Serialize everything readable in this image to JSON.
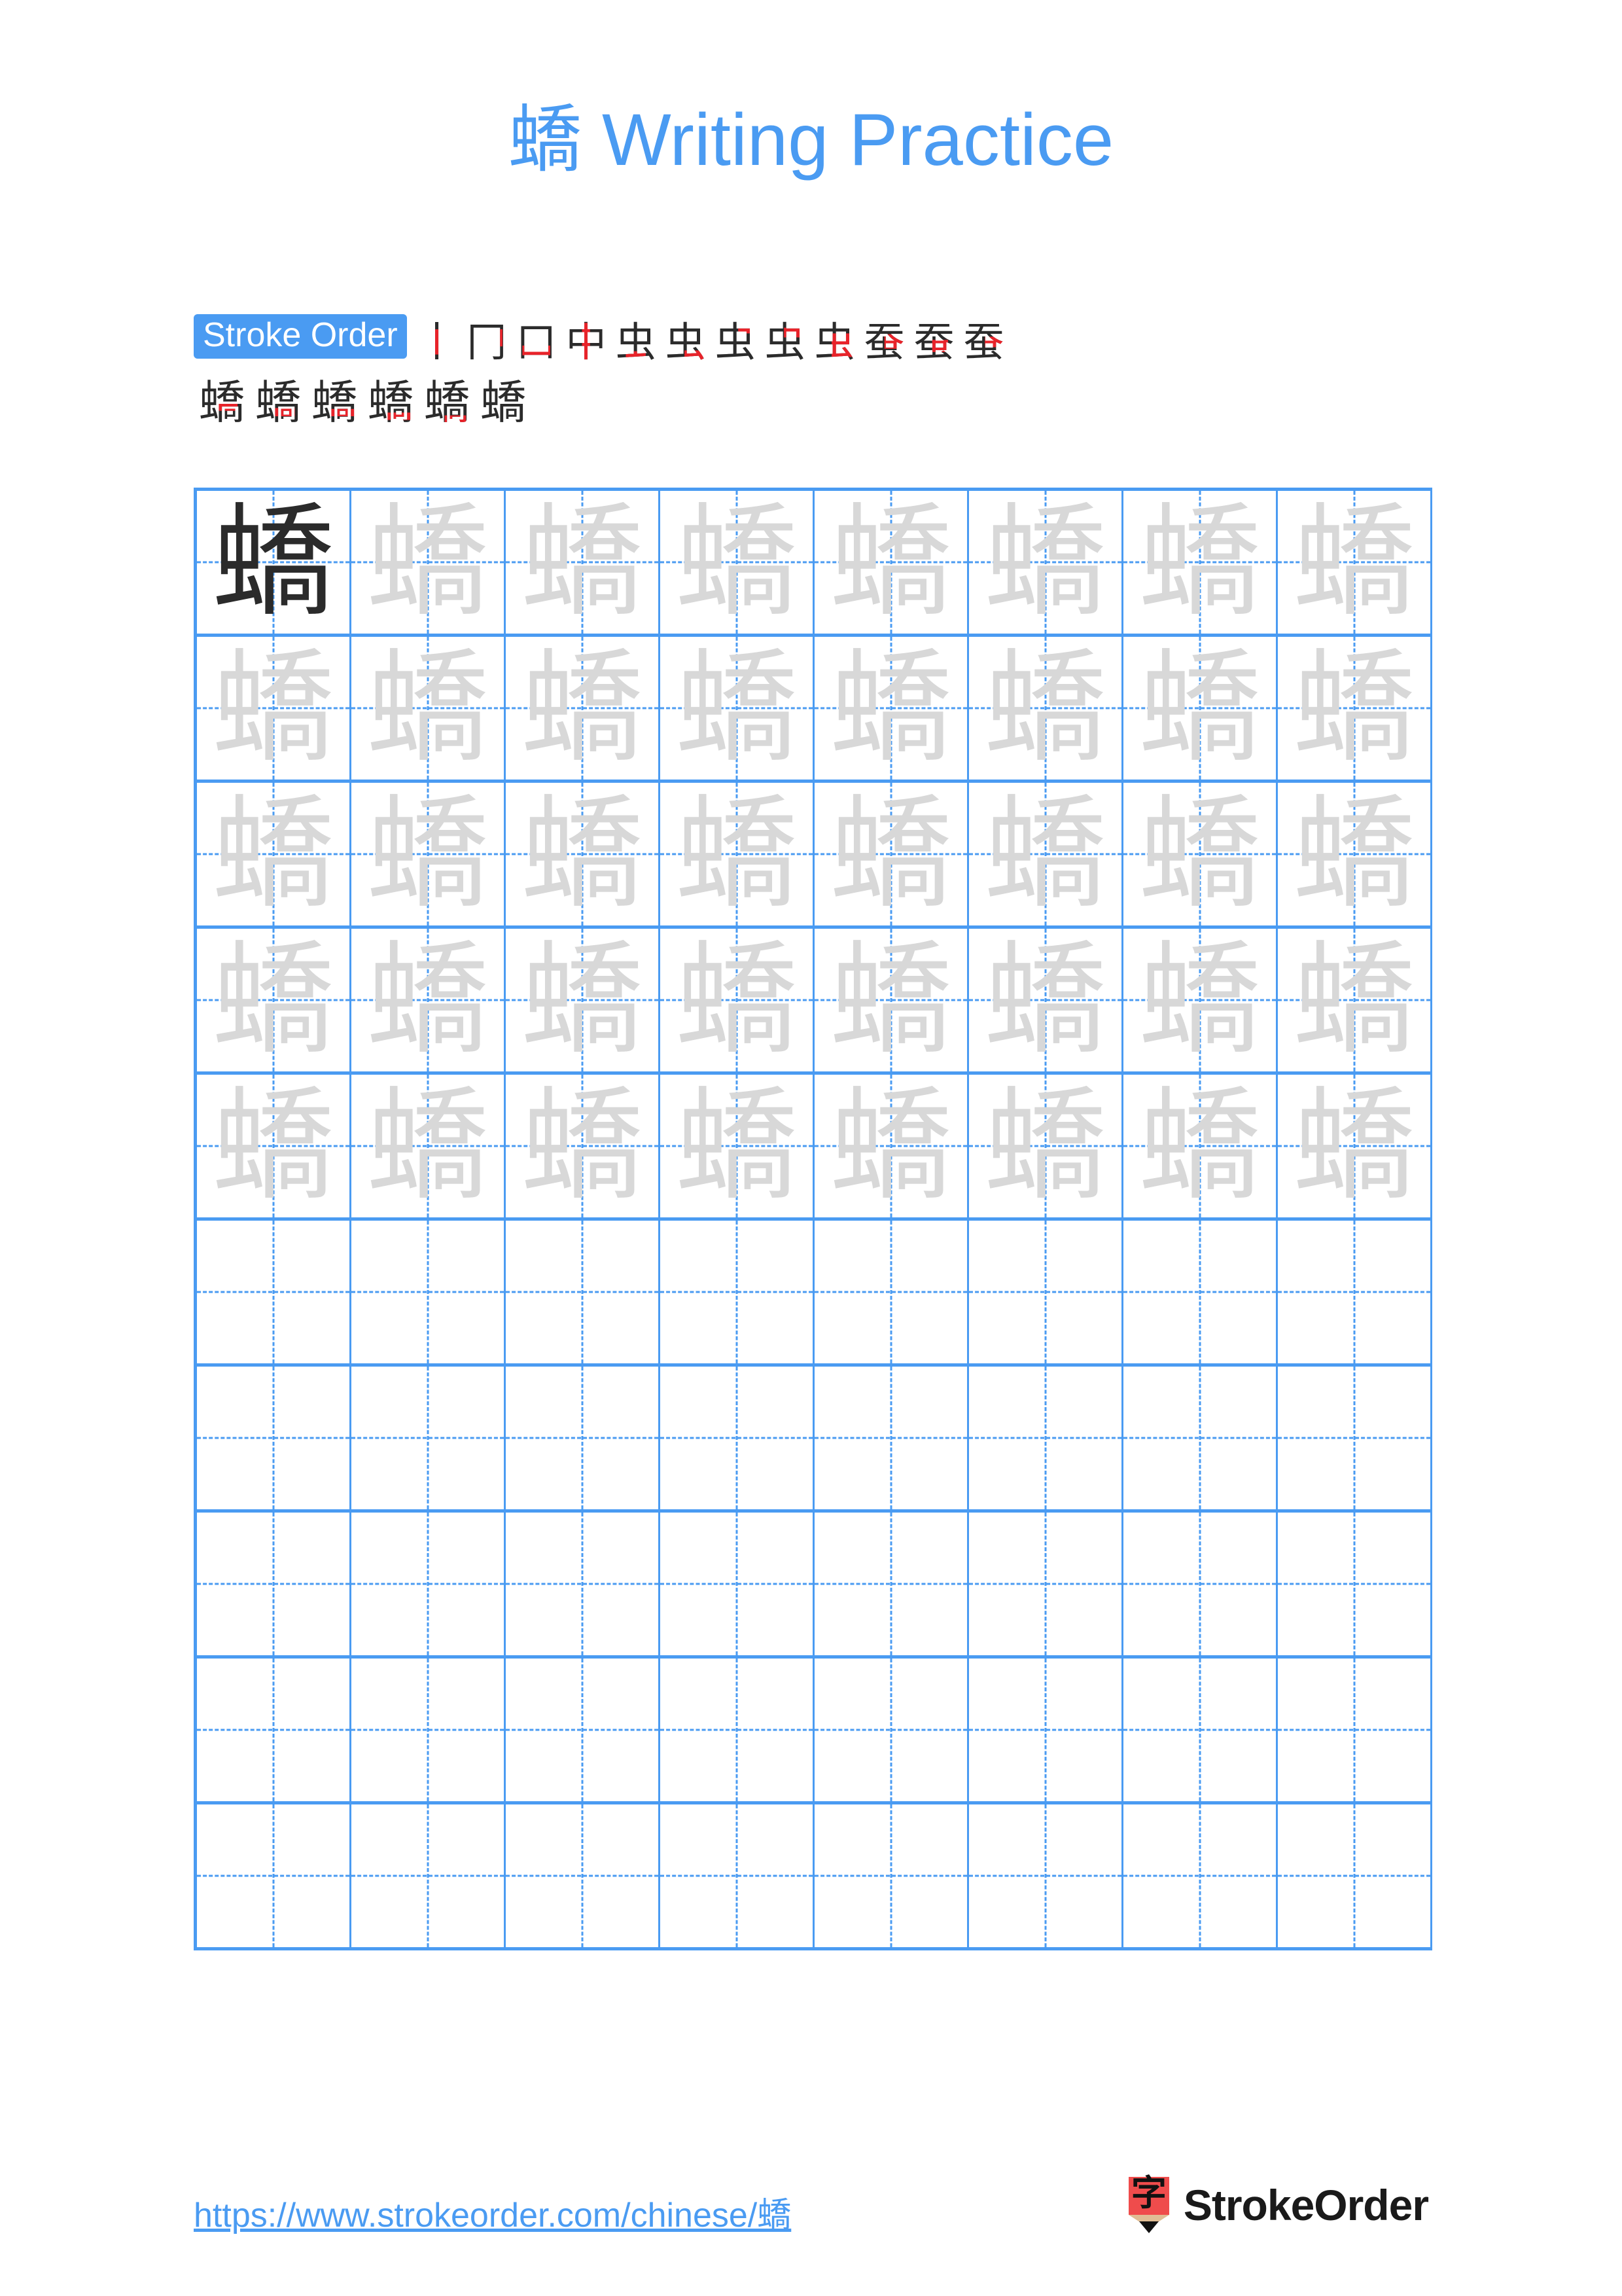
{
  "page": {
    "character": "蟜",
    "title": "蟜 Writing Practice",
    "background_color": "#ffffff",
    "accent_color": "#4a9bf2",
    "stroke_highlight_color": "#e8232a",
    "trace_color": "#d8d8d8",
    "model_color": "#2b2b2b"
  },
  "stroke_order": {
    "badge_label": "Stroke Order",
    "total_strokes": 18,
    "row1": [
      "丨",
      "冂",
      "口",
      "虫",
      "虫",
      "虫",
      "虫",
      "虫",
      "虫",
      "虫",
      "虫",
      "蚕"
    ],
    "row2": [
      "蟜",
      "蟜",
      "蟜",
      "蟜",
      "蟜",
      "蟜"
    ],
    "steps": [
      {
        "index": 1,
        "glyph": "丨"
      },
      {
        "index": 2,
        "glyph": "冂"
      },
      {
        "index": 3,
        "glyph": "口"
      },
      {
        "index": 4,
        "glyph": "中"
      },
      {
        "index": 5,
        "glyph": "虫"
      },
      {
        "index": 6,
        "glyph": "虫"
      },
      {
        "index": 7,
        "glyph": "虫"
      },
      {
        "index": 8,
        "glyph": "虫"
      },
      {
        "index": 9,
        "glyph": "虫"
      },
      {
        "index": 10,
        "glyph": "蚕"
      },
      {
        "index": 11,
        "glyph": "蚕"
      },
      {
        "index": 12,
        "glyph": "蚕"
      },
      {
        "index": 13,
        "glyph": "蟜"
      },
      {
        "index": 14,
        "glyph": "蟜"
      },
      {
        "index": 15,
        "glyph": "蟜"
      },
      {
        "index": 16,
        "glyph": "蟜"
      },
      {
        "index": 17,
        "glyph": "蟜"
      },
      {
        "index": 18,
        "glyph": "蟜"
      }
    ]
  },
  "grid": {
    "columns": 8,
    "rows": 10,
    "filled_rows": 5,
    "empty_rows": 5,
    "model_cell": {
      "row": 1,
      "col": 1,
      "char": "蟜"
    },
    "trace_char": "蟜"
  },
  "footer": {
    "url": "https://www.strokeorder.com/chinese/蟜",
    "brand_name": "StrokeOrder",
    "logo_char": "字",
    "logo_body_color": "#ef4c4c",
    "logo_wood_color": "#e0bd94",
    "logo_tip_color": "#111111"
  }
}
